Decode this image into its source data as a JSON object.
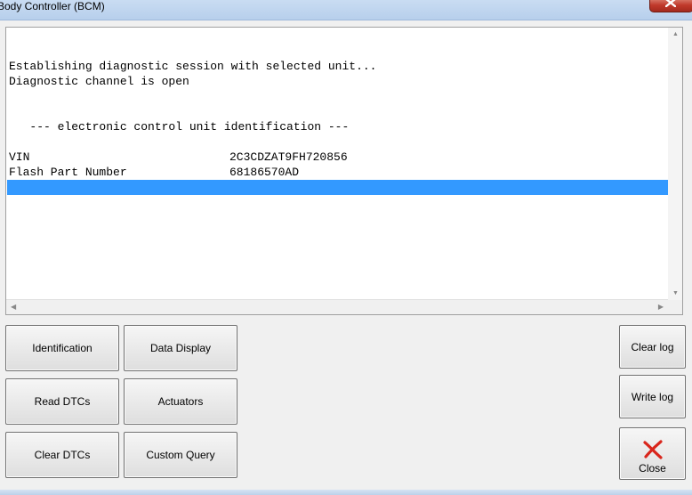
{
  "window": {
    "title": "Body Controller (BCM)"
  },
  "log": {
    "lines": [
      {
        "text": "",
        "value": ""
      },
      {
        "text": "Establishing diagnostic session with selected unit...",
        "value": ""
      },
      {
        "text": "Diagnostic channel is open",
        "value": ""
      },
      {
        "text": "",
        "value": ""
      },
      {
        "text": "",
        "value": ""
      },
      {
        "text": "   --- electronic control unit identification ---",
        "value": ""
      },
      {
        "text": "",
        "value": ""
      },
      {
        "text": "VIN",
        "value": "2C3CDZAT9FH720856"
      },
      {
        "text": "Flash Part Number",
        "value": "68186570AD"
      },
      {
        "text": "",
        "value": "",
        "selected": true
      }
    ]
  },
  "buttons": {
    "identification": "Identification",
    "data_display": "Data Display",
    "read_dtcs": "Read DTCs",
    "actuators": "Actuators",
    "clear_dtcs": "Clear DTCs",
    "custom_query": "Custom Query",
    "clear_log": "Clear log",
    "write_log": "Write log",
    "close": "Close"
  },
  "colors": {
    "selection": "#3399ff",
    "close_icon": "#d9261c"
  },
  "icons": {
    "close_button": "red-x-icon",
    "window_close": "close-icon"
  }
}
